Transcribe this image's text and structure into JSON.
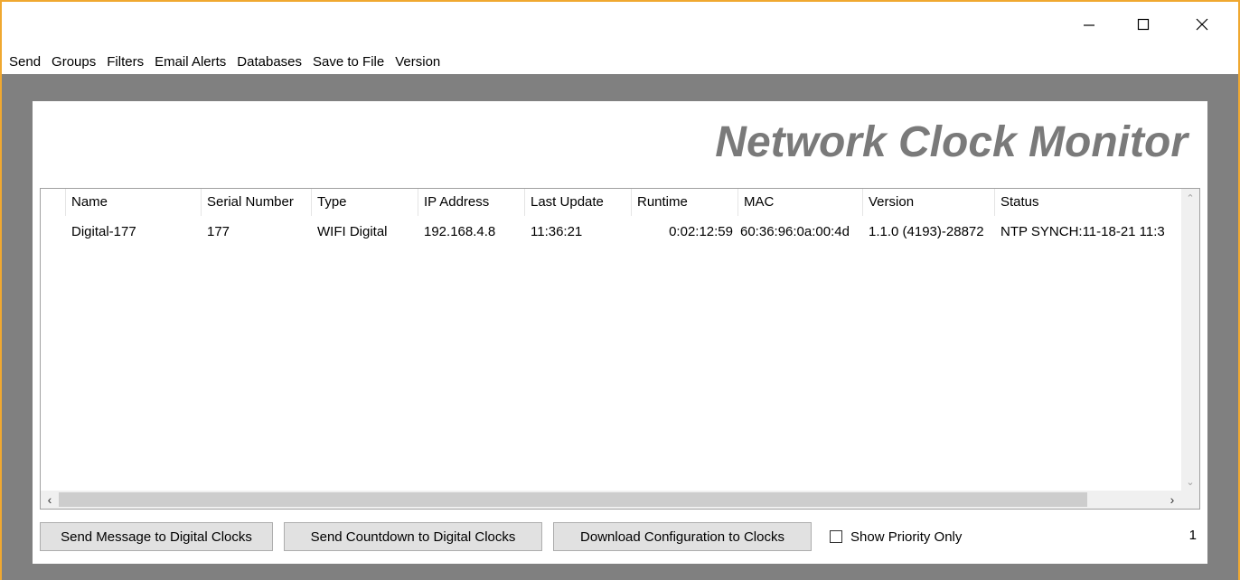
{
  "window": {
    "controls": {
      "minimize": "minimize-icon",
      "maximize": "maximize-icon",
      "close": "close-icon"
    }
  },
  "menu": [
    "Send",
    "Groups",
    "Filters",
    "Email Alerts",
    "Databases",
    "Save to File",
    "Version"
  ],
  "app_title": "Network Clock Monitor",
  "table": {
    "columns": [
      "Name",
      "Serial Number",
      "Type",
      "IP Address",
      "Last Update",
      "Runtime",
      "MAC",
      "Version",
      "Status"
    ],
    "rows": [
      {
        "name": "Digital-177",
        "serial": "177",
        "type": "WIFI Digital",
        "ip": "192.168.4.8",
        "last_update": "11:36:21",
        "runtime": "0:02:12:59",
        "mac": "60:36:96:0a:00:4d",
        "version": "1.1.0 (4193)-28872",
        "status": "NTP SYNCH:11-18-21 11:3"
      }
    ]
  },
  "buttons": {
    "send_message": "Send Message to Digital Clocks",
    "send_countdown": "Send Countdown to Digital Clocks",
    "download_config": "Download Configuration to Clocks"
  },
  "show_priority": {
    "label": "Show Priority Only",
    "checked": false
  },
  "count": "1",
  "colors": {
    "window_border": "#f0a830",
    "workarea": "#808080",
    "title_text": "#7a7a7a"
  }
}
